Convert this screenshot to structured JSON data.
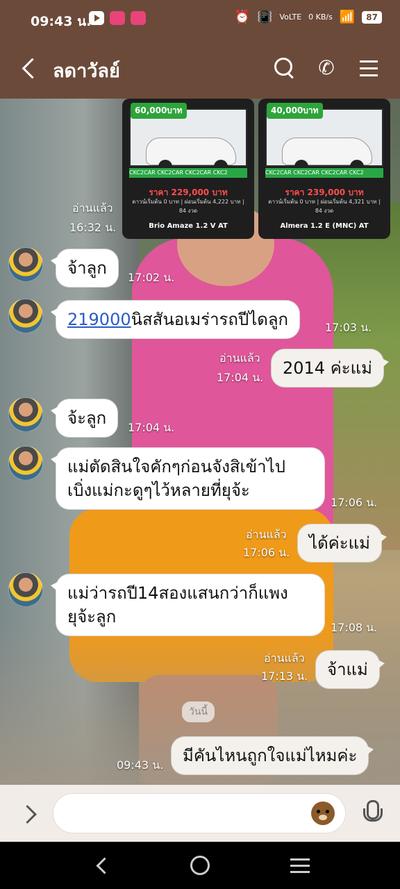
{
  "status_bar": {
    "time": "09:43 น.",
    "lte": "VoLTE",
    "speed_value": "0",
    "speed_unit": "KB/s",
    "battery": "87"
  },
  "header": {
    "title": "ลดาวัลย์"
  },
  "images": [
    {
      "promo": "60,000บาท",
      "strip": "CKC2CAR CKC2CAR CKC2CAR CKC2",
      "price": "ราคา 229,000 บาท",
      "terms": "ดาวน์เริ่มต้น 0 บาท | ผ่อนเริ่มต้น 4,222 บาท | 84 งวด",
      "model": "Brio Amaze 1.2 V AT"
    },
    {
      "promo": "40,000บาท",
      "strip": "CKC2CAR CKC2CAR CKC2CAR CKC2",
      "price": "ราคา 239,000 บาท",
      "terms": "ดาวน์เริ่มต้น 0 บาท | ผ่อนเริ่มต้น 4,321 บาท | 84 งวด",
      "model": "Almera 1.2 E (MNC) AT"
    }
  ],
  "messages": [
    {
      "read": "อ่านแล้ว",
      "time": "16:32 น."
    },
    {
      "text": "จ้าลูก",
      "time": "17:02 น."
    },
    {
      "link": "219000",
      "text": "นิสสันอเมร่ารถปีไดลูก",
      "time": "17:03 น."
    },
    {
      "text": "2014 ค่ะแม่",
      "read": "อ่านแล้ว",
      "time": "17:04 น."
    },
    {
      "text": "จ้ะลูก",
      "time": "17:04 น."
    },
    {
      "line1": "แม่ตัดสินใจคักๆก่อนจังสิเข้าไป",
      "line2": "เบิ่งแม่กะดูๆไว้หลายที่ยุจ้ะ",
      "time": "17:06 น."
    },
    {
      "text": "ได้ค่ะแม่",
      "read": "อ่านแล้ว",
      "time": "17:06 น."
    },
    {
      "line1": "แม่ว่ารถปี14สองแสนกว่าก็แพง",
      "line2": "ยุจ้ะลูก",
      "time": "17:08 น."
    },
    {
      "text": "จ้าแม่",
      "read": "อ่านแล้ว",
      "time": "17:13 น."
    },
    {
      "text": "มีคันไหนถูกใจแม่ไหมค่ะ",
      "time": "09:43 น."
    }
  ],
  "date_chip": "วันนี้",
  "input": {
    "placeholder": ""
  }
}
